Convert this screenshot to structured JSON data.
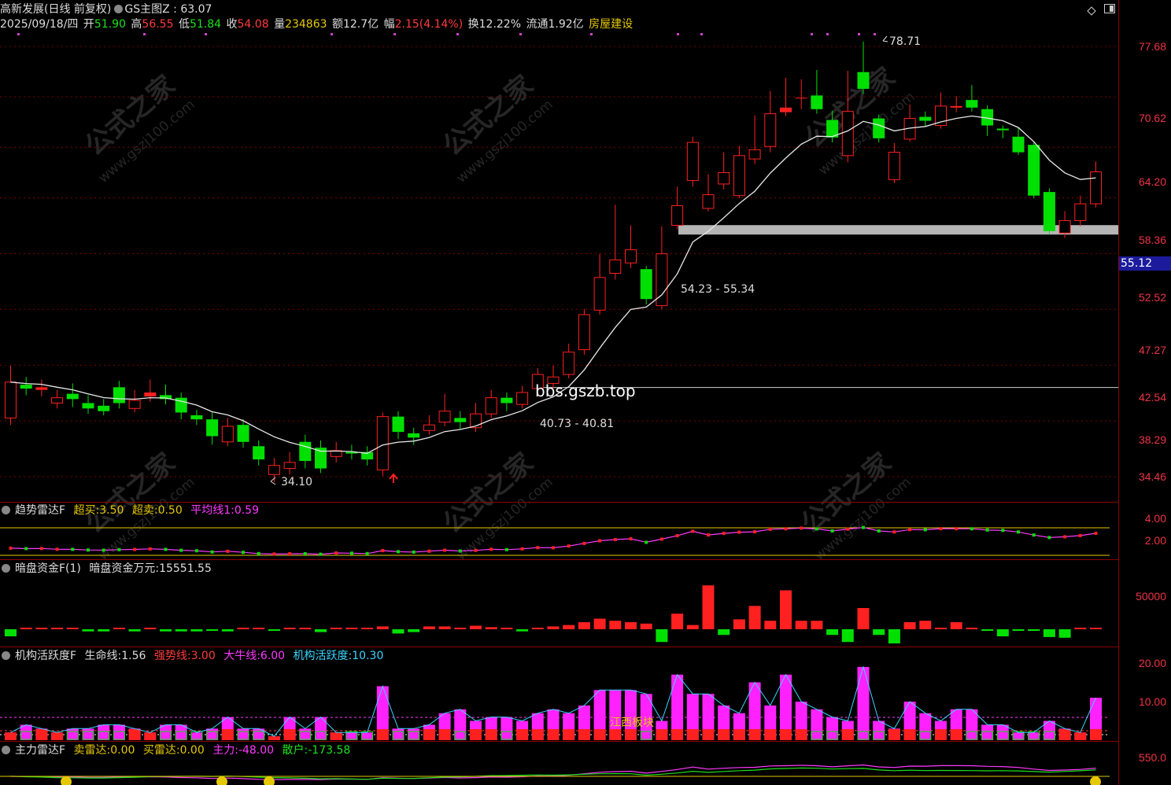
{
  "header": {
    "stock_name": "高新发展(日线 前复权)",
    "indicator": "GS主图Z : 63.07",
    "date": "2025/09/18/四",
    "open_label": "开",
    "open_value": "51.90",
    "high_label": "高",
    "high_value": "56.55",
    "low_label": "低",
    "low_value": "51.84",
    "close_label": "收",
    "close_value": "54.08",
    "volume_label": "量",
    "volume_value": "234863",
    "amount_label": "额",
    "amount_value": "12.7亿",
    "range_label": "幅",
    "range_value": "2.15(4.14%)",
    "turnover_label": "换",
    "turnover_value": "12.22%",
    "float_label": "流通",
    "float_value": "1.92亿",
    "sector": "房屋建设"
  },
  "main_chart": {
    "type": "candlestick",
    "price_axis": [
      "77.68",
      "70.62",
      "64.20",
      "58.36",
      "52.52",
      "47.27",
      "42.54",
      "38.29",
      "34.46"
    ],
    "current_price": "55.12",
    "annotations": {
      "high_mark": "78.71",
      "low_mark": "34.10",
      "support_zone": "54.23 - 55.34",
      "line_zone": "40.73 - 40.81",
      "watermark_site": "bbs.gszb.top"
    },
    "colors": {
      "up": "#ff2020",
      "down": "#00e000",
      "ma": "#e8e8e8"
    },
    "candles": [
      [
        38.5,
        41.2,
        42.5,
        38.0
      ],
      [
        41.0,
        40.7,
        41.6,
        40.2
      ],
      [
        40.6,
        40.8,
        41.4,
        40.1
      ],
      [
        39.6,
        40.0,
        40.6,
        39.2
      ],
      [
        40.3,
        39.9,
        41.1,
        39.3
      ],
      [
        39.6,
        39.2,
        40.2,
        38.8
      ],
      [
        39.4,
        39.0,
        39.9,
        38.7
      ],
      [
        40.8,
        39.6,
        41.3,
        39.2
      ],
      [
        39.2,
        39.8,
        40.6,
        38.9
      ],
      [
        40.1,
        40.4,
        41.4,
        39.7
      ],
      [
        40.2,
        39.9,
        41.0,
        39.5
      ],
      [
        40.0,
        38.9,
        40.4,
        38.4
      ],
      [
        38.7,
        38.4,
        39.1,
        38.0
      ],
      [
        38.4,
        37.2,
        38.9,
        36.6
      ],
      [
        36.8,
        37.9,
        38.5,
        36.5
      ],
      [
        38.0,
        36.8,
        38.4,
        36.4
      ],
      [
        36.5,
        35.6,
        36.9,
        35.2
      ],
      [
        34.6,
        35.2,
        35.7,
        34.1
      ],
      [
        35.0,
        35.4,
        36.1,
        34.6
      ],
      [
        36.8,
        35.5,
        37.3,
        35.0
      ],
      [
        36.4,
        35.0,
        36.9,
        34.7
      ],
      [
        35.8,
        36.2,
        36.8,
        35.4
      ],
      [
        36.1,
        36.0,
        36.6,
        35.6
      ],
      [
        36.1,
        35.6,
        36.5,
        35.2
      ],
      [
        34.9,
        38.6,
        38.9,
        34.5
      ],
      [
        38.6,
        37.5,
        39.0,
        37.0
      ],
      [
        37.4,
        37.1,
        37.8,
        36.6
      ],
      [
        37.6,
        38.0,
        38.7,
        37.3
      ],
      [
        38.2,
        39.0,
        40.3,
        37.9
      ],
      [
        38.5,
        38.2,
        39.0,
        37.7
      ],
      [
        37.8,
        38.8,
        39.6,
        37.5
      ],
      [
        38.8,
        40.0,
        40.6,
        38.5
      ],
      [
        40.0,
        39.6,
        40.4,
        39.0
      ],
      [
        39.5,
        40.4,
        40.9,
        39.2
      ],
      [
        40.7,
        41.8,
        42.3,
        40.4
      ],
      [
        41.1,
        41.6,
        42.5,
        40.7
      ],
      [
        41.8,
        43.6,
        44.3,
        41.5
      ],
      [
        43.8,
        46.8,
        47.3,
        43.4
      ],
      [
        47.2,
        50.2,
        52.5,
        46.8
      ],
      [
        50.6,
        51.9,
        57.6,
        50.0
      ],
      [
        51.6,
        52.9,
        55.4,
        51.1
      ],
      [
        51.0,
        48.2,
        51.3,
        47.7
      ],
      [
        47.6,
        52.5,
        55.3,
        47.3
      ],
      [
        55.4,
        57.5,
        59.6,
        55.0
      ],
      [
        60.3,
        64.8,
        65.5,
        59.6
      ],
      [
        57.2,
        58.7,
        61.0,
        56.9
      ],
      [
        59.9,
        61.2,
        63.6,
        59.3
      ],
      [
        58.6,
        63.2,
        64.4,
        58.3
      ],
      [
        62.8,
        63.9,
        68.2,
        62.2
      ],
      [
        64.3,
        68.4,
        71.4,
        63.6
      ],
      [
        68.6,
        69.2,
        73.2,
        68.1
      ],
      [
        70.4,
        70.5,
        73.0,
        69.0
      ],
      [
        70.8,
        69.0,
        74.3,
        68.4
      ],
      [
        67.6,
        65.4,
        68.8,
        64.8
      ],
      [
        63.2,
        68.7,
        74.2,
        62.4
      ],
      [
        74.0,
        71.7,
        78.4,
        71.0
      ],
      [
        67.8,
        65.3,
        68.3,
        64.8
      ],
      [
        60.4,
        63.6,
        64.7,
        60.0
      ],
      [
        65.2,
        67.8,
        69.6,
        64.9
      ],
      [
        68.0,
        67.5,
        68.7,
        66.8
      ],
      [
        66.9,
        69.4,
        71.2,
        66.5
      ],
      [
        69.2,
        69.4,
        70.7,
        68.6
      ],
      [
        70.2,
        69.2,
        72.2,
        68.7
      ],
      [
        69.0,
        66.9,
        69.5,
        65.6
      ],
      [
        66.5,
        66.3,
        66.9,
        65.3
      ],
      [
        65.5,
        63.6,
        66.6,
        63.3
      ],
      [
        64.5,
        58.6,
        64.8,
        58.3
      ],
      [
        59.0,
        54.8,
        59.4,
        54.5
      ],
      [
        54.6,
        55.9,
        56.9,
        54.1
      ],
      [
        55.9,
        57.7,
        58.6,
        55.3
      ],
      [
        57.7,
        61.3,
        62.5,
        57.3
      ]
    ]
  },
  "panel_trend": {
    "name": "趋势雷达F",
    "items": [
      {
        "label": "超买:",
        "value": "3.50"
      },
      {
        "label": "超卖:",
        "value": "0.50"
      },
      {
        "label": "平均线1:",
        "value": "0.59"
      }
    ],
    "axis": [
      "4.00",
      "2.00"
    ]
  },
  "panel_funds": {
    "name": "暗盘资金F(1)",
    "items": [
      {
        "label": "暗盘资金万元:",
        "value": "15551.55"
      }
    ],
    "axis": [
      "50000"
    ]
  },
  "panel_inst": {
    "name": "机构活跃度F",
    "items": [
      {
        "label": "生命线:",
        "value": "1.56"
      },
      {
        "label": "强势线:",
        "value": "3.00"
      },
      {
        "label": "大牛线:",
        "value": "6.00"
      },
      {
        "label": "机构活跃度:",
        "value": "10.30"
      }
    ],
    "axis": [
      "20.00",
      "10.00"
    ],
    "note": "江西板块"
  },
  "panel_main_force": {
    "name": "主力雷达F",
    "items": [
      {
        "label": "卖雷达:",
        "value": "0.00"
      },
      {
        "label": "买雷达:",
        "value": "0.00"
      },
      {
        "label": "主力:",
        "value": "-48.00"
      },
      {
        "label": "散户:",
        "value": "-173.58"
      }
    ],
    "axis": [
      "550.0"
    ]
  },
  "watermark": {
    "cn": "公式之家",
    "url": "www.gszj100.com"
  }
}
